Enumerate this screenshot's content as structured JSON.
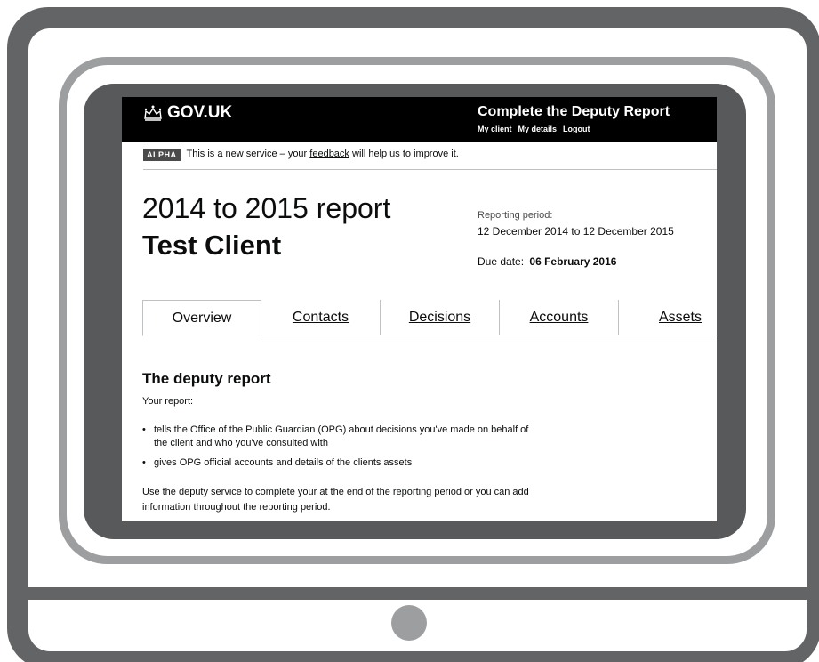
{
  "header": {
    "logo_text": "GOV.UK",
    "service_title": "Complete the Deputy Report",
    "links": [
      "My client",
      "My details",
      "Logout"
    ]
  },
  "phase_banner": {
    "tag": "ALPHA",
    "text_before": "This is a new service – your ",
    "link": "feedback",
    "text_after": " will help us to improve it."
  },
  "report": {
    "title": "2014 to 2015 report",
    "client_name": "Test Client",
    "period_label": "Reporting period:",
    "period_value": "12 December 2014 to 12 December 2015",
    "due_label": "Due date:",
    "due_value": "06 February 2016"
  },
  "tabs": [
    {
      "label": "Overview",
      "active": true
    },
    {
      "label": "Contacts",
      "active": false
    },
    {
      "label": "Decisions",
      "active": false
    },
    {
      "label": "Accounts",
      "active": false
    },
    {
      "label": "Assets",
      "active": false
    }
  ],
  "content": {
    "heading": "The deputy report",
    "intro": "Your report:",
    "bullets": [
      "tells the Office of the Public Guardian (OPG) about decisions you've made on behalf of the client and who you've consulted with",
      "gives OPG official accounts and details of the clients assets"
    ],
    "closing": "Use the deputy service to complete your at the end of the reporting period or you can add information throughout the reporting period."
  },
  "colors": {
    "frame_dark": "#636466",
    "frame_light": "#9d9ea0",
    "bezel": "#58595b",
    "header_bg": "#000000",
    "text": "#0b0c0c"
  },
  "icons": {
    "logo": "crown-icon"
  }
}
